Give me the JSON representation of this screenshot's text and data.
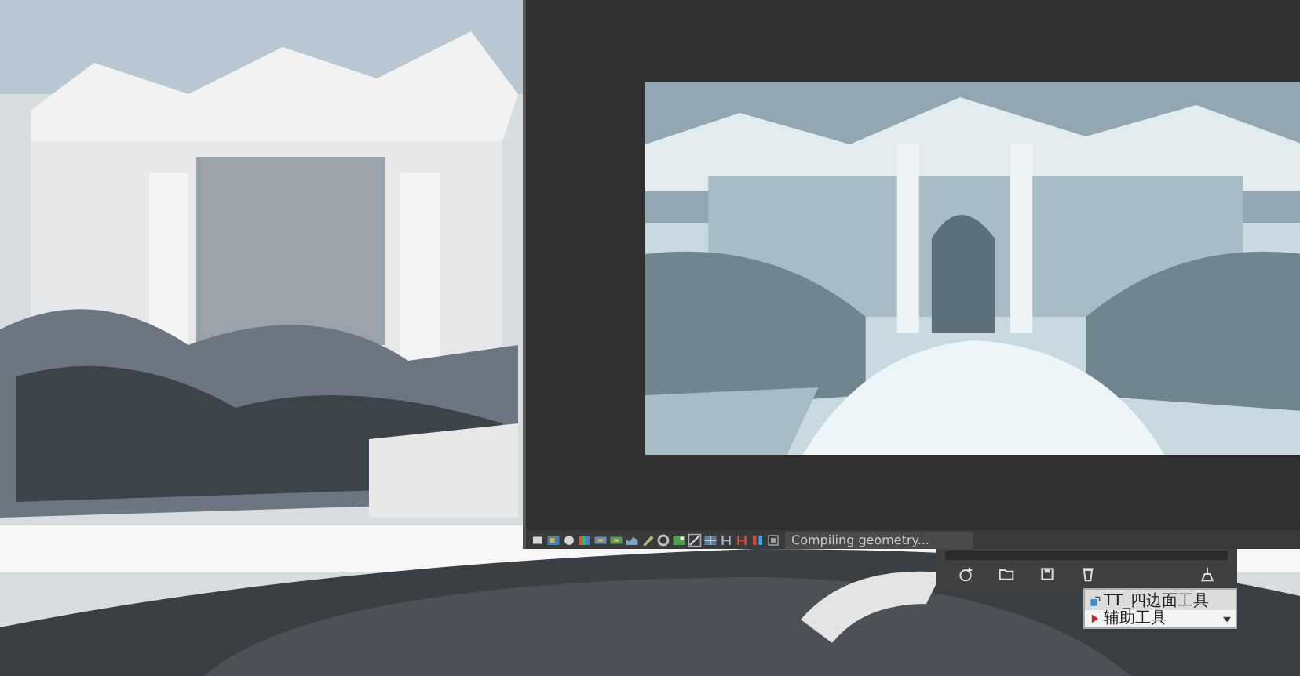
{
  "frame_buffer": {
    "status": "Compiling geometry..."
  },
  "tool_list": {
    "items": [
      {
        "label": "TT_四边面工具",
        "kind": "tool"
      },
      {
        "label": "辅助工具",
        "kind": "folder"
      }
    ]
  }
}
